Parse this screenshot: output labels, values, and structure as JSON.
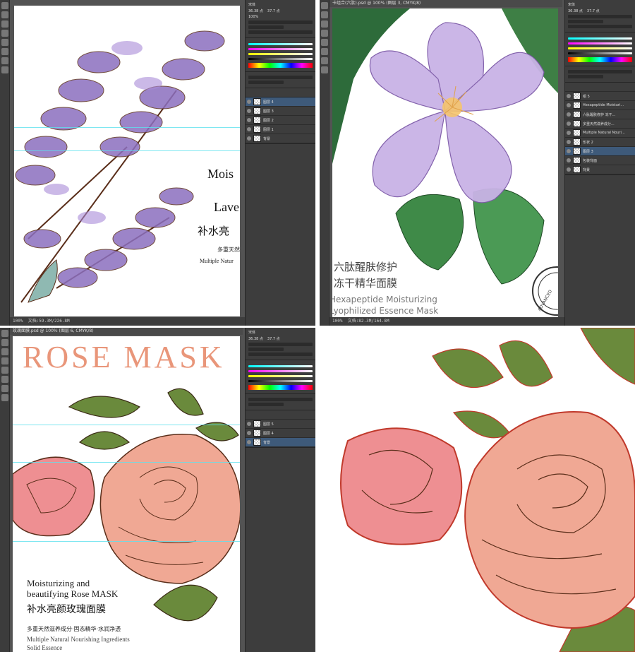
{
  "q1": {
    "zoom": "100%",
    "doc_status": "文档:59.3M/226.8M",
    "panel_font": "宋体",
    "size_a": "36.38 点",
    "size_b": "37.7 点",
    "percent": "100%",
    "layers": [
      {
        "name": "图层 4",
        "selected": true
      },
      {
        "name": "图层 3",
        "selected": false
      },
      {
        "name": "图层 2",
        "selected": false
      },
      {
        "name": "图层 1",
        "selected": false
      },
      {
        "name": "背景",
        "selected": false
      }
    ],
    "text_line1": "Mois",
    "text_line2": "Lave",
    "text_cn": "补水亮",
    "text_cn_small": "多重天然",
    "text_en_small": "Multiple Natur"
  },
  "q2": {
    "title": "卡组合(六肽).psd @ 100% (图层 3, CMYK/8)",
    "zoom": "100%",
    "doc_status": "文档:82.3M/164.8M",
    "panel_font": "宋体",
    "size_a": "36.38 点",
    "size_b": "37.7 点",
    "text_cn1": "六肽醒肤修护",
    "text_cn2": "冻干精华面膜",
    "text_en1": "Hexapeptide Moisturizing",
    "text_en2": "Lyophilized Essence Mask",
    "stamp_text": "ADVANCED",
    "layers": [
      {
        "name": "组 5",
        "selected": false
      },
      {
        "name": "Hexapeptide Moisturi...",
        "selected": false
      },
      {
        "name": "六肽醒肤修护 冻干...",
        "selected": false
      },
      {
        "name": "多重天然滋养成分...",
        "selected": false
      },
      {
        "name": "Multiple Natural Nouri...",
        "selected": false
      },
      {
        "name": "形状 2",
        "selected": false
      },
      {
        "name": "图层 3",
        "selected": true
      },
      {
        "name": "包装背面",
        "selected": false
      },
      {
        "name": "背景",
        "selected": false
      }
    ]
  },
  "q3": {
    "title": "玫瑰面膜.psd @ 100% (图层 6, CMYK/8)",
    "zoom": "100%",
    "doc_status": "文档:49.3M/180.2M",
    "panel_font": "宋体",
    "size_a": "36.38 点",
    "size_b": "37.7 点",
    "heading": "ROSE MASK",
    "en_title_1": "Moisturizing and",
    "en_title_2": "beautifying Rose MASK",
    "cn_title": "补水亮颜玫瑰面膜",
    "cn_sub": "多重天然滋养成分·固态精华·水润净透",
    "en_sub_1": "Multiple Natural Nourishing Ingredients",
    "en_sub_2": "Solid Essence",
    "layers": [
      {
        "name": "图层 5",
        "selected": false
      },
      {
        "name": "图层 4",
        "selected": false
      },
      {
        "name": "背景",
        "selected": true
      }
    ]
  },
  "colors": {
    "ps_bg": "#535353",
    "ps_panel": "#3d3d3d",
    "guide": "#5ee1ee",
    "rose_title": "#e9967a",
    "rose_pink": "#ee8f92",
    "rose_peach": "#f0a894",
    "leaf_green": "#6a8a3c",
    "lavender": "#8b6fbf",
    "ink_brown": "#5a2e1a"
  }
}
